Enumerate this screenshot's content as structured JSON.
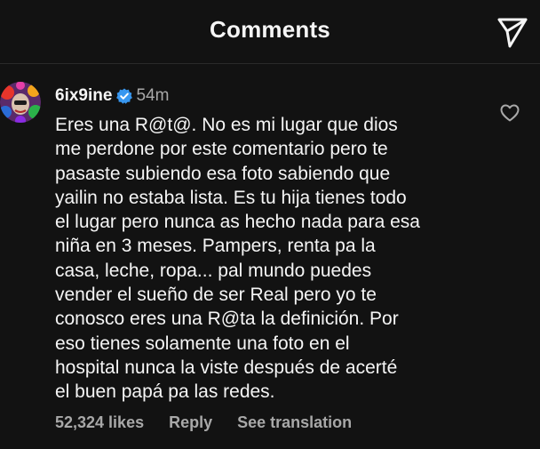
{
  "header": {
    "title": "Comments",
    "share_icon": "send-icon"
  },
  "comment": {
    "username": "6ix9ine",
    "verified": true,
    "verified_color": "#3897f0",
    "time_ago": "54m",
    "text": "Eres una R@t@. No es mi lugar que dios\nme perdone por este comentario pero te\npasaste subiendo esa foto sabiendo que\nyailin no estaba lista. Es tu hija tienes todo\nel lugar pero nunca as hecho nada para esa\nniña en 3 meses. Pampers, renta pa la\ncasa, leche, ropa... pal mundo puedes\nvender el sueño de ser Real pero yo te\nconosco eres una R@ta la definición. Por\neso tienes solamente una foto en el\nhospital nunca la viste después de acerté\nel buen papá pa las redes.",
    "likes": "52,324 likes",
    "reply_label": "Reply",
    "translate_label": "See translation",
    "like_icon": "heart-outline-icon"
  },
  "colors": {
    "background": "#121212",
    "text": "#f5f5f5",
    "secondary_text": "#a8a8a8"
  }
}
